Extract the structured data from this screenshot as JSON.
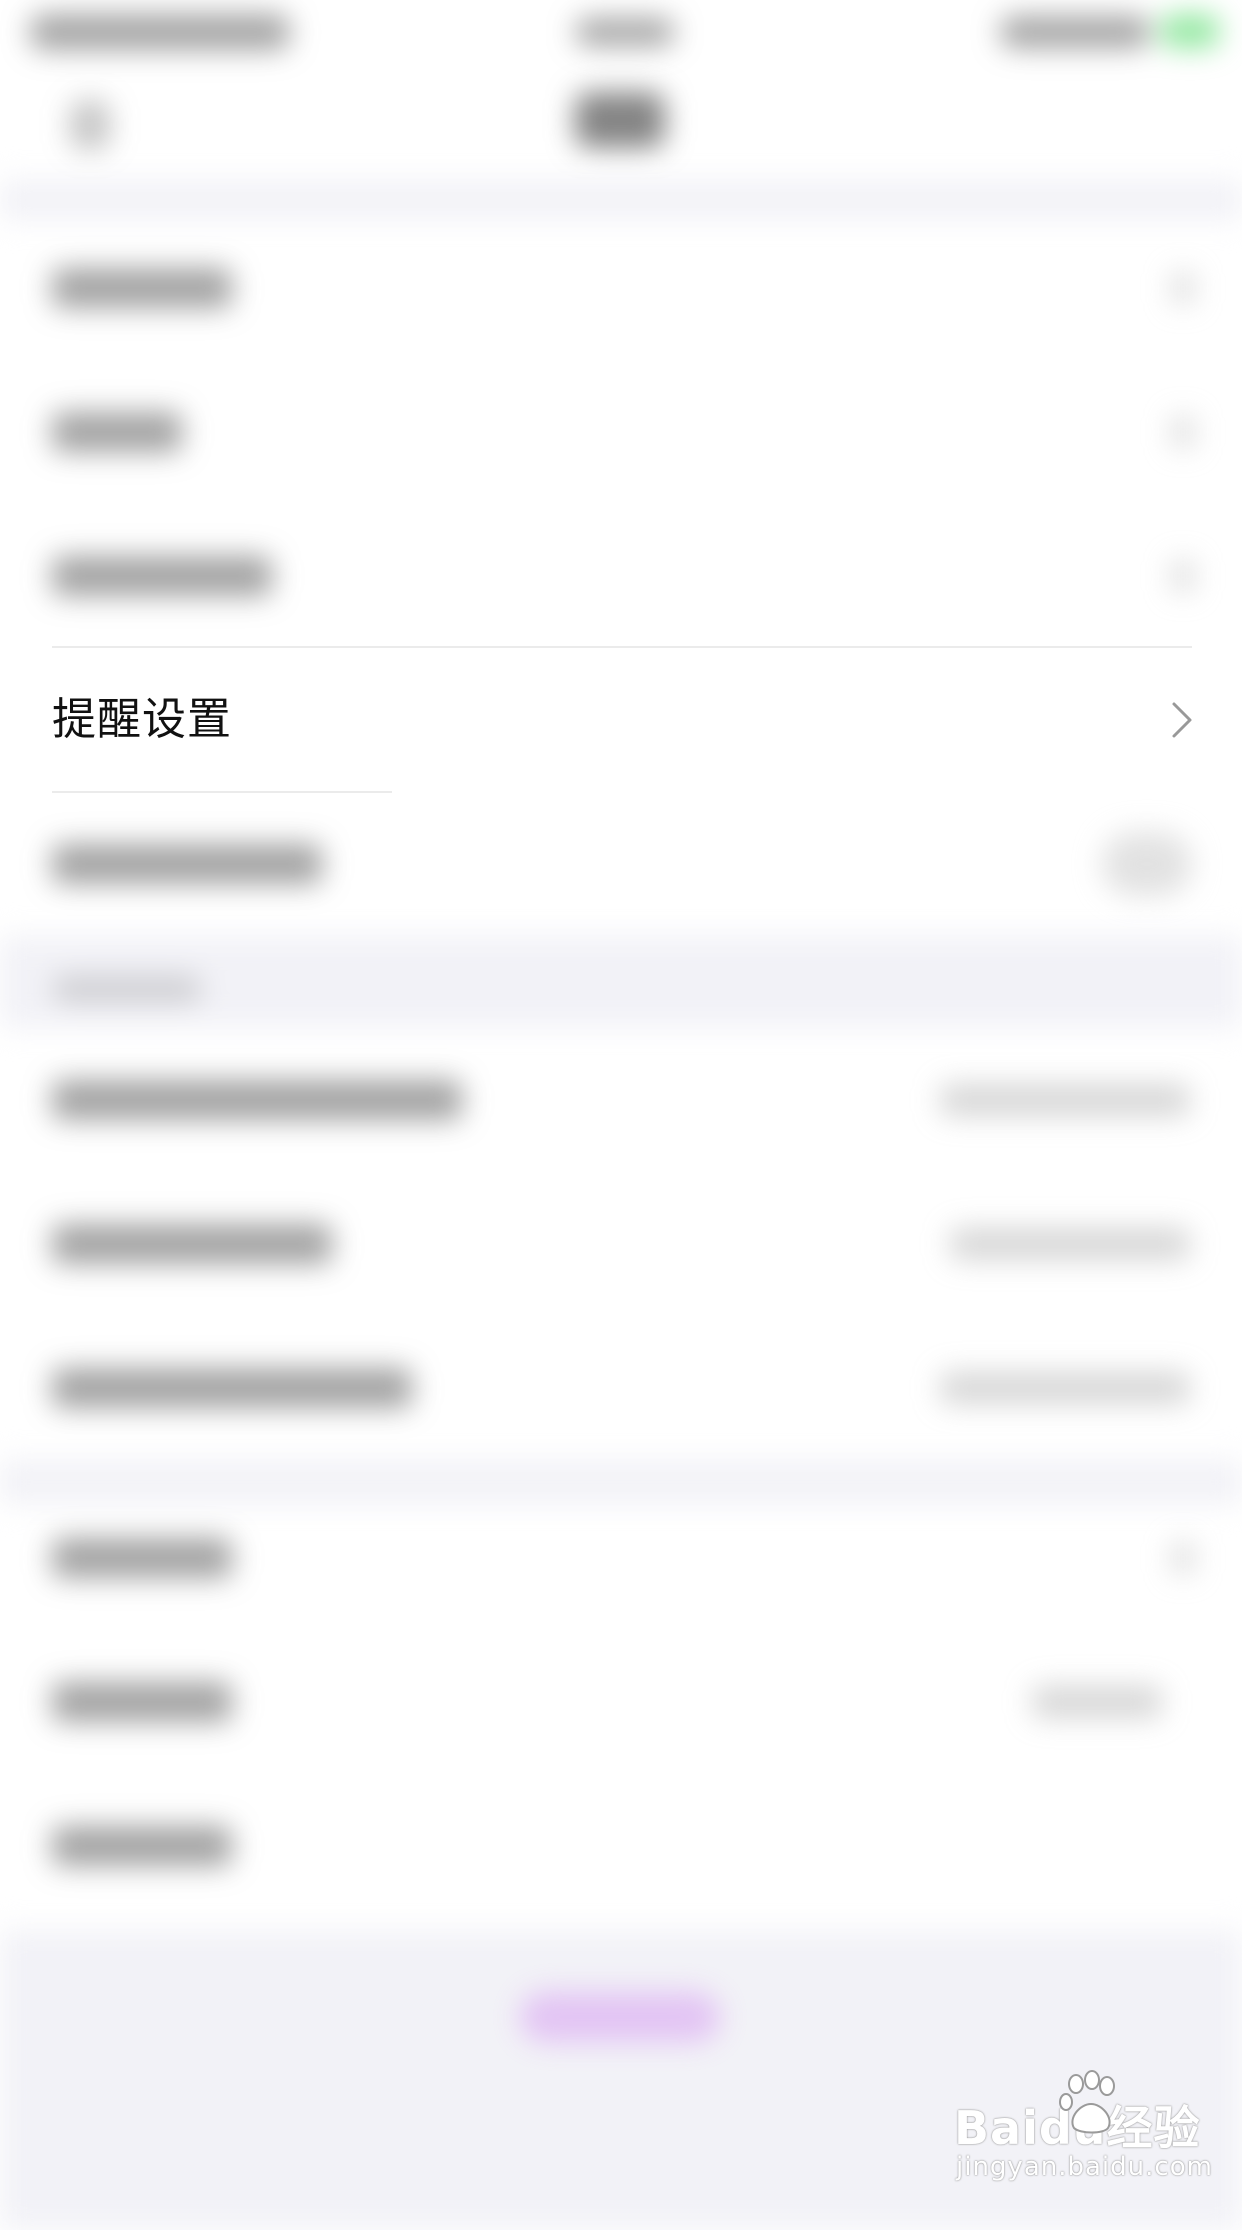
{
  "focused_item": {
    "label": "提醒设置"
  },
  "watermark": {
    "brand_text": "Baidu经验",
    "url_text": "jingyan.baidu.com"
  },
  "colors": {
    "background": "#ffffff",
    "section_gap": "#f2f2f7",
    "text": "#111111",
    "chevron": "#999999",
    "bottom_accent": "#d08cf0"
  },
  "icons": {
    "focused_item_chevron": "chevron-right-icon",
    "watermark_logo": "baidu-paw-icon"
  }
}
